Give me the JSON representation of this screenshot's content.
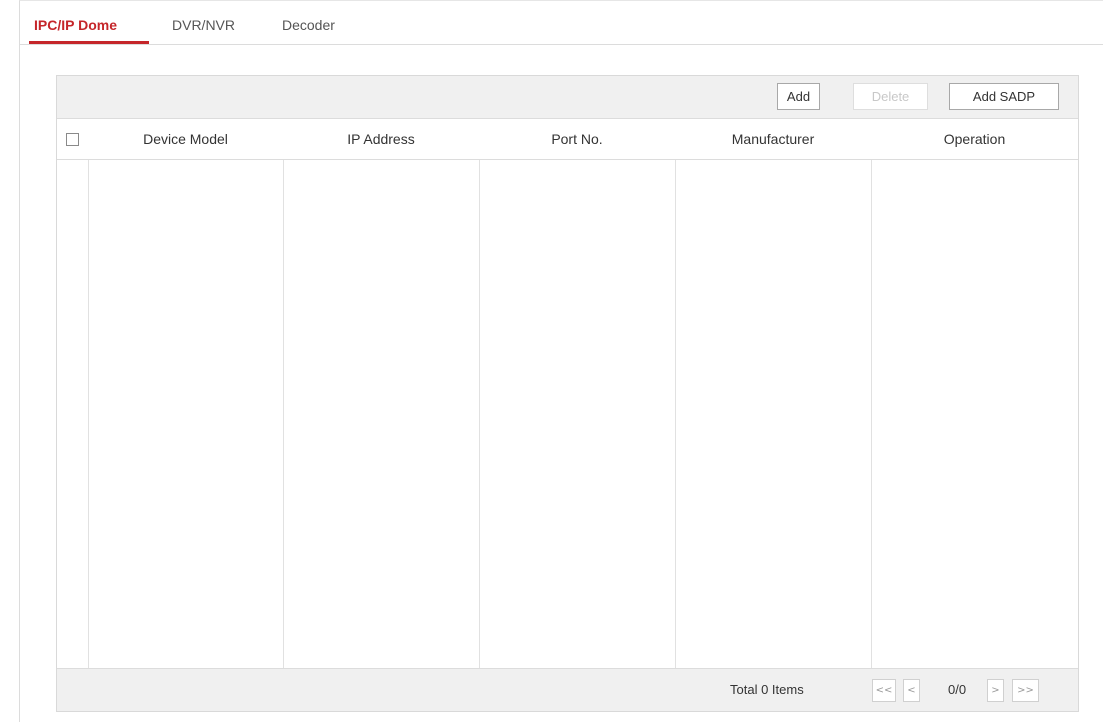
{
  "tabs": [
    {
      "label": "IPC/IP Dome",
      "active": true
    },
    {
      "label": "DVR/NVR",
      "active": false
    },
    {
      "label": "Decoder",
      "active": false
    }
  ],
  "toolbar": {
    "add_label": "Add",
    "delete_label": "Delete",
    "add_sadp_label": "Add SADP"
  },
  "table": {
    "columns": [
      "Device Model",
      "IP Address",
      "Port No.",
      "Manufacturer",
      "Operation"
    ],
    "rows": [],
    "select_all_checked": false
  },
  "pagination": {
    "total_label": "Total 0 Items",
    "first": "<<",
    "prev": "<",
    "page_indicator": "0/0",
    "next": ">",
    "last": ">>"
  },
  "colors": {
    "accent": "#c5262a",
    "toolbar_bg": "#f0f0f0",
    "border": "#dcdcdc"
  }
}
